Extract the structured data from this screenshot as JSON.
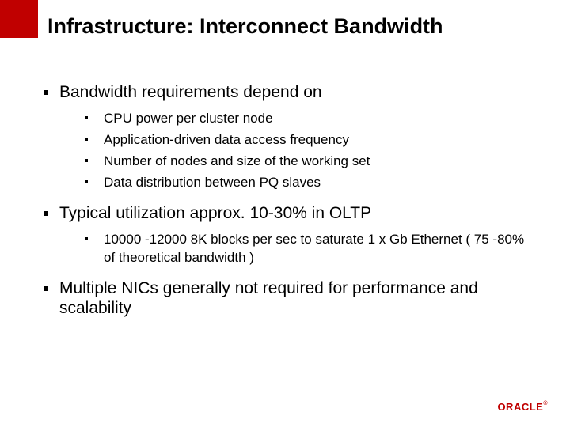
{
  "title": "Infrastructure: Interconnect Bandwidth",
  "bullets": [
    {
      "text": "Bandwidth requirements depend on",
      "sub": [
        "CPU power per cluster node",
        "Application-driven data access frequency",
        "Number of nodes and size of the working set",
        "Data distribution between PQ slaves"
      ]
    },
    {
      "text": "Typical utilization approx. 10-30% in OLTP",
      "sub": [
        " 10000 -12000 8K blocks per sec to saturate 1 x Gb Ethernet ( 75 -80% of theoretical bandwidth )"
      ]
    },
    {
      "text": "Multiple NICs generally not required for performance and scalability",
      "sub": []
    }
  ],
  "logo": "ORACLE"
}
